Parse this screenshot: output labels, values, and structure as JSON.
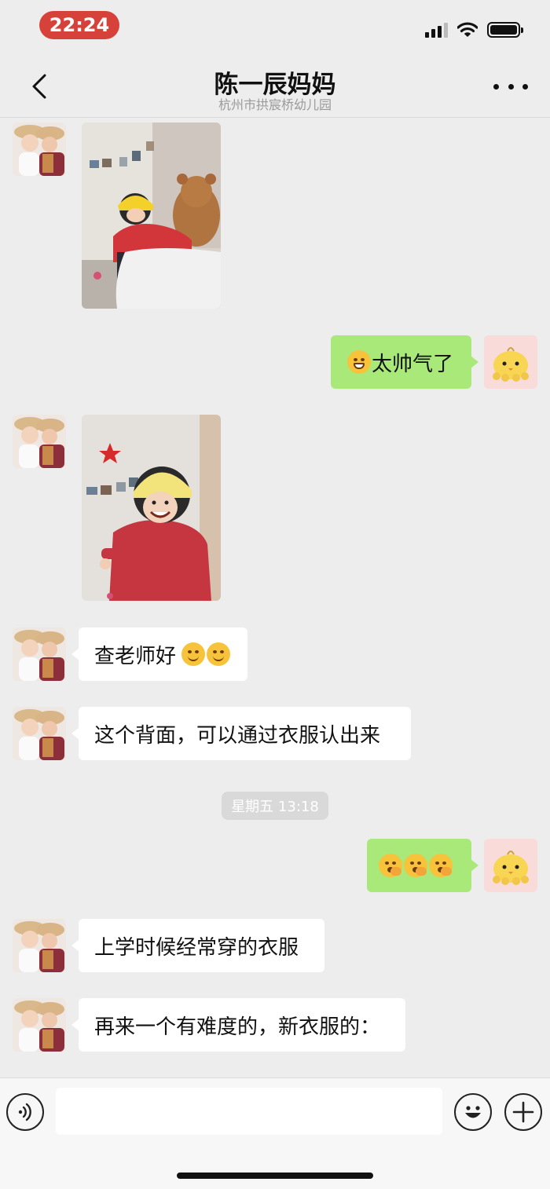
{
  "status_bar": {
    "time": "22:24",
    "icons": [
      "signal-icon",
      "wifi-icon",
      "battery-icon"
    ]
  },
  "nav": {
    "title": "陈一辰妈妈",
    "subtitle": "杭州市拱宸桥幼儿园",
    "back_icon": "chevron-left-icon",
    "more_icon": "more-dots-icon"
  },
  "messages": [
    {
      "side": "in",
      "type": "image",
      "content": "photo-child-red-jacket-helmet-teddy-bear"
    },
    {
      "side": "out",
      "type": "text",
      "emoji_prefix": "grin-emoji",
      "text": "太帅气了"
    },
    {
      "side": "in",
      "type": "image",
      "content": "photo-child-smiling-helmet-red-jacket"
    },
    {
      "side": "in",
      "type": "text",
      "text": "查老师好",
      "emoji_suffix": [
        "smile-emoji",
        "smile-emoji"
      ]
    },
    {
      "side": "in",
      "type": "text",
      "text": "这个背面，可以通过衣服认出来"
    },
    {
      "type": "time",
      "text": "星期五 13:18"
    },
    {
      "side": "out",
      "type": "emoji",
      "emojis": [
        "yawn-emoji",
        "yawn-emoji",
        "yawn-emoji"
      ]
    },
    {
      "side": "in",
      "type": "text",
      "text": "上学时候经常穿的衣服"
    },
    {
      "side": "in",
      "type": "text",
      "text": "再来一个有难度的，新衣服的："
    }
  ],
  "input_bar": {
    "voice_icon": "voice-icon",
    "input_value": "",
    "emoji_icon": "emoji-face-icon",
    "plus_icon": "plus-icon"
  },
  "colors": {
    "background": "#ededed",
    "bubble_out": "#a9e97a",
    "bubble_in": "#ffffff",
    "time_pill": "#d6423a"
  }
}
